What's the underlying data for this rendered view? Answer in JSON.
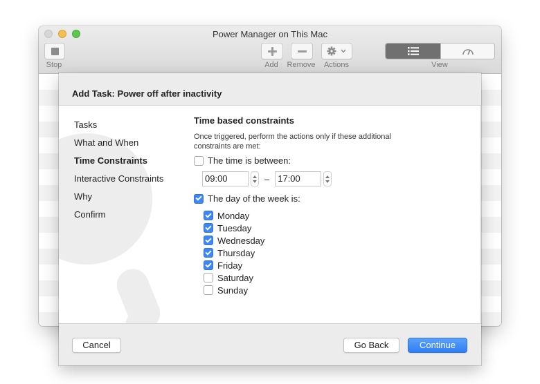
{
  "window": {
    "title": "Power Manager on This Mac"
  },
  "toolbar": {
    "stop_label": "Stop",
    "add_label": "Add",
    "remove_label": "Remove",
    "actions_label": "Actions",
    "view_label": "View",
    "icons": {
      "stop": "stop-icon",
      "add": "plus-icon",
      "remove": "minus-icon",
      "actions": "gear-icon",
      "view_list": "list-icon",
      "view_gauge": "gauge-icon"
    }
  },
  "sheet": {
    "title": "Add Task: Power off after inactivity",
    "steps": [
      {
        "label": "Tasks",
        "active": false
      },
      {
        "label": "What and When",
        "active": false
      },
      {
        "label": "Time Constraints",
        "active": true
      },
      {
        "label": "Interactive Constraints",
        "active": false
      },
      {
        "label": "Why",
        "active": false
      },
      {
        "label": "Confirm",
        "active": false
      }
    ],
    "section_title": "Time based constraints",
    "description": "Once triggered, perform the actions only if these additional constraints are met:",
    "time_between": {
      "label": "The time is between:",
      "checked": false,
      "start": "09:00",
      "separator": "–",
      "end": "17:00"
    },
    "day_of_week": {
      "label": "The day of the week is:",
      "checked": true,
      "days": [
        {
          "label": "Monday",
          "checked": true
        },
        {
          "label": "Tuesday",
          "checked": true
        },
        {
          "label": "Wednesday",
          "checked": true
        },
        {
          "label": "Thursday",
          "checked": true
        },
        {
          "label": "Friday",
          "checked": true
        },
        {
          "label": "Saturday",
          "checked": false
        },
        {
          "label": "Sunday",
          "checked": false
        }
      ]
    },
    "buttons": {
      "cancel": "Cancel",
      "go_back": "Go Back",
      "continue": "Continue"
    }
  },
  "colors": {
    "accent": "#3d86f5",
    "sheet_bg": "#ececec"
  }
}
